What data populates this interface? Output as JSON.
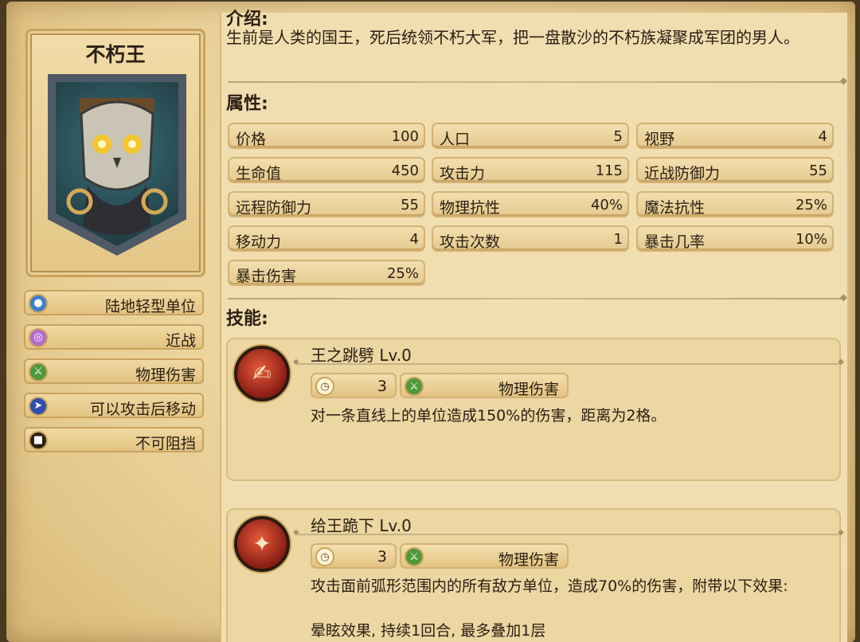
{
  "unit": {
    "name": "不朽王",
    "traits": [
      {
        "label": "陆地轻型单位",
        "icon": "person-icon",
        "color": "#3b7fc9"
      },
      {
        "label": "近战",
        "icon": "target-icon",
        "color": "#b46bd0"
      },
      {
        "label": "物理伤害",
        "icon": "sword-icon",
        "color": "#4e9a3a"
      },
      {
        "label": "可以攻击后移动",
        "icon": "move-icon",
        "color": "#2d4fb0"
      },
      {
        "label": "不可阻挡",
        "icon": "unstoppable-icon",
        "color": "#2b2014"
      }
    ]
  },
  "intro": {
    "heading": "介绍:",
    "text": "生前是人类的国王，死后统领不朽大军，把一盘散沙的不朽族凝聚成军团的男人。"
  },
  "attributes": {
    "heading": "属性:",
    "stats": [
      {
        "label": "价格",
        "value": "100"
      },
      {
        "label": "人口",
        "value": "5"
      },
      {
        "label": "视野",
        "value": "4"
      },
      {
        "label": "生命值",
        "value": "450"
      },
      {
        "label": "攻击力",
        "value": "115"
      },
      {
        "label": "近战防御力",
        "value": "55"
      },
      {
        "label": "远程防御力",
        "value": "55"
      },
      {
        "label": "物理抗性",
        "value": "40%"
      },
      {
        "label": "魔法抗性",
        "value": "25%"
      },
      {
        "label": "移动力",
        "value": "4"
      },
      {
        "label": "攻击次数",
        "value": "1"
      },
      {
        "label": "暴击几率",
        "value": "10%"
      },
      {
        "label": "暴击伤害",
        "value": "25%"
      }
    ]
  },
  "skills": {
    "heading": "技能:",
    "list": [
      {
        "name": "王之跳劈 Lv.0",
        "cooldown": "3",
        "damage_type": "物理伤害",
        "description": "对一条直线上的单位造成150%的伤害，距离为2格。",
        "description_extra": ""
      },
      {
        "name": "给王跪下 Lv.0",
        "cooldown": "3",
        "damage_type": "物理伤害",
        "description": "攻击面前弧形范围内的所有敌方单位，造成70%的伤害，附带以下效果:",
        "description_extra": "晕眩效果, 持续1回合, 最多叠加1层"
      }
    ]
  }
}
